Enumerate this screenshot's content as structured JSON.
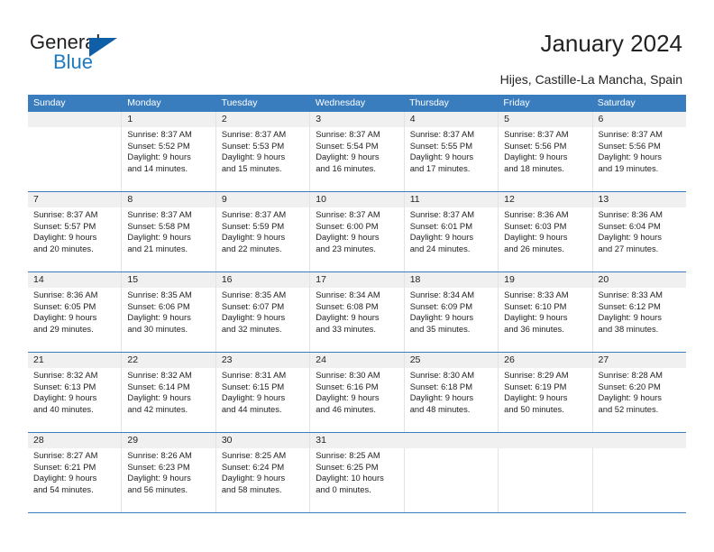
{
  "brand": {
    "name_part1": "General",
    "name_part2": "Blue",
    "accent_color": "#1d79c1",
    "triangle_color": "#0f5fa8"
  },
  "header": {
    "title": "January 2024",
    "location": "Hijes, Castille-La Mancha, Spain"
  },
  "calendar": {
    "header_color": "#3a7dbf",
    "daynum_band_color": "#f0f0f0",
    "day_names": [
      "Sunday",
      "Monday",
      "Tuesday",
      "Wednesday",
      "Thursday",
      "Friday",
      "Saturday"
    ],
    "weeks": [
      [
        {
          "day": "",
          "lines": []
        },
        {
          "day": "1",
          "lines": [
            "Sunrise: 8:37 AM",
            "Sunset: 5:52 PM",
            "Daylight: 9 hours",
            "and 14 minutes."
          ]
        },
        {
          "day": "2",
          "lines": [
            "Sunrise: 8:37 AM",
            "Sunset: 5:53 PM",
            "Daylight: 9 hours",
            "and 15 minutes."
          ]
        },
        {
          "day": "3",
          "lines": [
            "Sunrise: 8:37 AM",
            "Sunset: 5:54 PM",
            "Daylight: 9 hours",
            "and 16 minutes."
          ]
        },
        {
          "day": "4",
          "lines": [
            "Sunrise: 8:37 AM",
            "Sunset: 5:55 PM",
            "Daylight: 9 hours",
            "and 17 minutes."
          ]
        },
        {
          "day": "5",
          "lines": [
            "Sunrise: 8:37 AM",
            "Sunset: 5:56 PM",
            "Daylight: 9 hours",
            "and 18 minutes."
          ]
        },
        {
          "day": "6",
          "lines": [
            "Sunrise: 8:37 AM",
            "Sunset: 5:56 PM",
            "Daylight: 9 hours",
            "and 19 minutes."
          ]
        }
      ],
      [
        {
          "day": "7",
          "lines": [
            "Sunrise: 8:37 AM",
            "Sunset: 5:57 PM",
            "Daylight: 9 hours",
            "and 20 minutes."
          ]
        },
        {
          "day": "8",
          "lines": [
            "Sunrise: 8:37 AM",
            "Sunset: 5:58 PM",
            "Daylight: 9 hours",
            "and 21 minutes."
          ]
        },
        {
          "day": "9",
          "lines": [
            "Sunrise: 8:37 AM",
            "Sunset: 5:59 PM",
            "Daylight: 9 hours",
            "and 22 minutes."
          ]
        },
        {
          "day": "10",
          "lines": [
            "Sunrise: 8:37 AM",
            "Sunset: 6:00 PM",
            "Daylight: 9 hours",
            "and 23 minutes."
          ]
        },
        {
          "day": "11",
          "lines": [
            "Sunrise: 8:37 AM",
            "Sunset: 6:01 PM",
            "Daylight: 9 hours",
            "and 24 minutes."
          ]
        },
        {
          "day": "12",
          "lines": [
            "Sunrise: 8:36 AM",
            "Sunset: 6:03 PM",
            "Daylight: 9 hours",
            "and 26 minutes."
          ]
        },
        {
          "day": "13",
          "lines": [
            "Sunrise: 8:36 AM",
            "Sunset: 6:04 PM",
            "Daylight: 9 hours",
            "and 27 minutes."
          ]
        }
      ],
      [
        {
          "day": "14",
          "lines": [
            "Sunrise: 8:36 AM",
            "Sunset: 6:05 PM",
            "Daylight: 9 hours",
            "and 29 minutes."
          ]
        },
        {
          "day": "15",
          "lines": [
            "Sunrise: 8:35 AM",
            "Sunset: 6:06 PM",
            "Daylight: 9 hours",
            "and 30 minutes."
          ]
        },
        {
          "day": "16",
          "lines": [
            "Sunrise: 8:35 AM",
            "Sunset: 6:07 PM",
            "Daylight: 9 hours",
            "and 32 minutes."
          ]
        },
        {
          "day": "17",
          "lines": [
            "Sunrise: 8:34 AM",
            "Sunset: 6:08 PM",
            "Daylight: 9 hours",
            "and 33 minutes."
          ]
        },
        {
          "day": "18",
          "lines": [
            "Sunrise: 8:34 AM",
            "Sunset: 6:09 PM",
            "Daylight: 9 hours",
            "and 35 minutes."
          ]
        },
        {
          "day": "19",
          "lines": [
            "Sunrise: 8:33 AM",
            "Sunset: 6:10 PM",
            "Daylight: 9 hours",
            "and 36 minutes."
          ]
        },
        {
          "day": "20",
          "lines": [
            "Sunrise: 8:33 AM",
            "Sunset: 6:12 PM",
            "Daylight: 9 hours",
            "and 38 minutes."
          ]
        }
      ],
      [
        {
          "day": "21",
          "lines": [
            "Sunrise: 8:32 AM",
            "Sunset: 6:13 PM",
            "Daylight: 9 hours",
            "and 40 minutes."
          ]
        },
        {
          "day": "22",
          "lines": [
            "Sunrise: 8:32 AM",
            "Sunset: 6:14 PM",
            "Daylight: 9 hours",
            "and 42 minutes."
          ]
        },
        {
          "day": "23",
          "lines": [
            "Sunrise: 8:31 AM",
            "Sunset: 6:15 PM",
            "Daylight: 9 hours",
            "and 44 minutes."
          ]
        },
        {
          "day": "24",
          "lines": [
            "Sunrise: 8:30 AM",
            "Sunset: 6:16 PM",
            "Daylight: 9 hours",
            "and 46 minutes."
          ]
        },
        {
          "day": "25",
          "lines": [
            "Sunrise: 8:30 AM",
            "Sunset: 6:18 PM",
            "Daylight: 9 hours",
            "and 48 minutes."
          ]
        },
        {
          "day": "26",
          "lines": [
            "Sunrise: 8:29 AM",
            "Sunset: 6:19 PM",
            "Daylight: 9 hours",
            "and 50 minutes."
          ]
        },
        {
          "day": "27",
          "lines": [
            "Sunrise: 8:28 AM",
            "Sunset: 6:20 PM",
            "Daylight: 9 hours",
            "and 52 minutes."
          ]
        }
      ],
      [
        {
          "day": "28",
          "lines": [
            "Sunrise: 8:27 AM",
            "Sunset: 6:21 PM",
            "Daylight: 9 hours",
            "and 54 minutes."
          ]
        },
        {
          "day": "29",
          "lines": [
            "Sunrise: 8:26 AM",
            "Sunset: 6:23 PM",
            "Daylight: 9 hours",
            "and 56 minutes."
          ]
        },
        {
          "day": "30",
          "lines": [
            "Sunrise: 8:25 AM",
            "Sunset: 6:24 PM",
            "Daylight: 9 hours",
            "and 58 minutes."
          ]
        },
        {
          "day": "31",
          "lines": [
            "Sunrise: 8:25 AM",
            "Sunset: 6:25 PM",
            "Daylight: 10 hours",
            "and 0 minutes."
          ]
        },
        {
          "day": "",
          "lines": []
        },
        {
          "day": "",
          "lines": []
        },
        {
          "day": "",
          "lines": []
        }
      ]
    ]
  }
}
